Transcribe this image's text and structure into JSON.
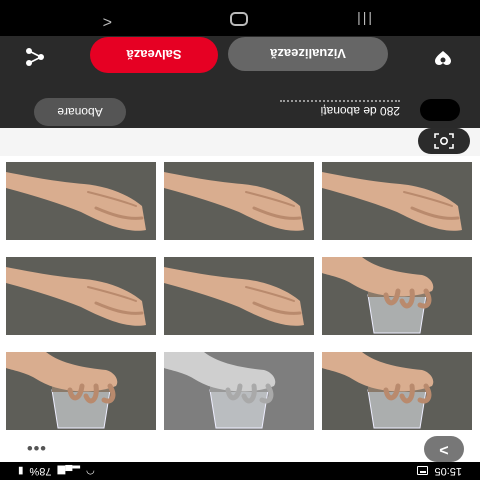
{
  "status_bar": {
    "time": "15:05",
    "battery": "78%",
    "left_icons": [
      "notification-icon"
    ],
    "right_icons": [
      "wifi-icon",
      "signal-icon",
      "battery-icon"
    ]
  },
  "header": {
    "followers": "280 de abonați",
    "follow_label": "Abonare",
    "visualize_label": "Vizualizează",
    "save_label": "Salvează",
    "save_color": "#e60023"
  },
  "feed": {
    "next_symbol": ">",
    "more_symbol": "•••"
  },
  "navigation": {
    "recent_symbol": "|||",
    "back_symbol": "<"
  },
  "grid": {
    "items": [
      {
        "subject": "hand-holding-glass",
        "tone": "color"
      },
      {
        "subject": "hand-holding-glass",
        "tone": "grayscale"
      },
      {
        "subject": "hand-holding-glass",
        "tone": "color"
      },
      {
        "subject": "hand-holding-glass",
        "tone": "color"
      },
      {
        "subject": "hand-relaxed",
        "tone": "color"
      },
      {
        "subject": "hand-relaxed",
        "tone": "color"
      },
      {
        "subject": "hand-relaxed",
        "tone": "color"
      },
      {
        "subject": "hand-relaxed",
        "tone": "color"
      },
      {
        "subject": "hand-relaxed",
        "tone": "color"
      }
    ]
  }
}
